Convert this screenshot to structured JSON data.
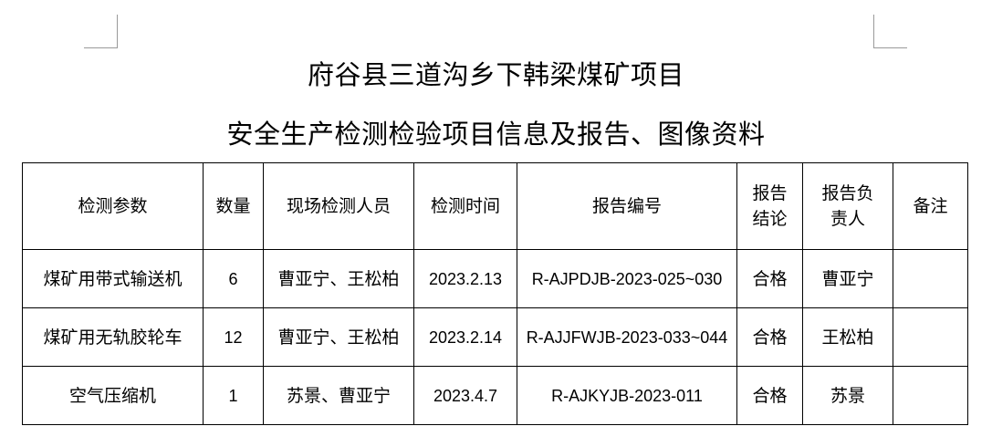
{
  "document": {
    "title_line1": "府谷县三道沟乡下韩梁煤矿项目",
    "title_line2": "安全生产检测检验项目信息及报告、图像资料"
  },
  "table": {
    "headers": {
      "param": "检测参数",
      "quantity": "数量",
      "personnel": "现场检测人员",
      "date": "检测时间",
      "report_no": "报告编号",
      "conclusion": "报告结论",
      "responsible": "报告负责人",
      "remarks": "备注"
    },
    "rows": [
      {
        "param": "煤矿用带式输送机",
        "quantity": "6",
        "personnel": "曹亚宁、王松柏",
        "date": "2023.2.13",
        "report_no": "R-AJPDJB-2023-025~030",
        "conclusion": "合格",
        "responsible": "曹亚宁",
        "remarks": ""
      },
      {
        "param": "煤矿用无轨胶轮车",
        "quantity": "12",
        "personnel": "曹亚宁、王松柏",
        "date": "2023.2.14",
        "report_no": "R-AJJFWJB-2023-033~044",
        "conclusion": "合格",
        "responsible": "王松柏",
        "remarks": ""
      },
      {
        "param": "空气压缩机",
        "quantity": "1",
        "personnel": "苏景、曹亚宁",
        "date": "2023.4.7",
        "report_no": "R-AJKYJB-2023-011",
        "conclusion": "合格",
        "responsible": "苏景",
        "remarks": ""
      }
    ]
  }
}
